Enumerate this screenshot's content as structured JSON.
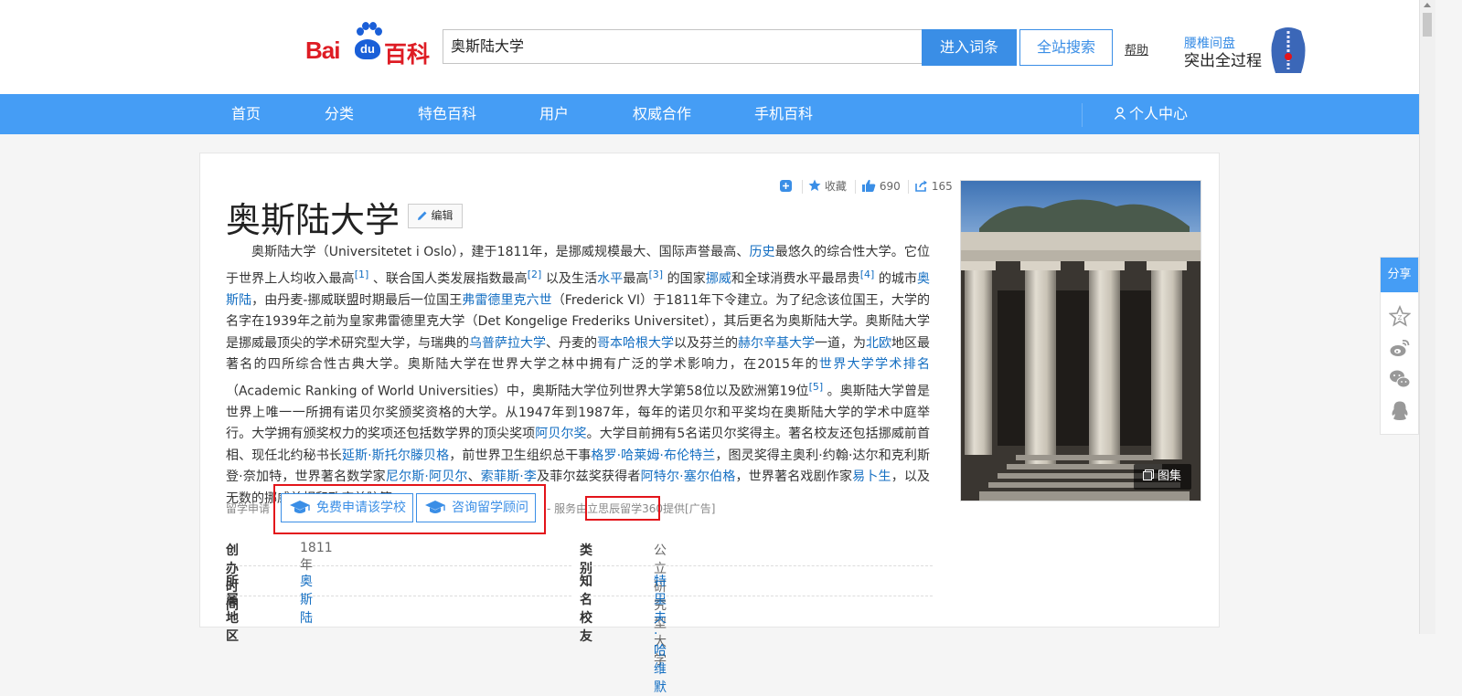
{
  "header": {
    "logo_text_left": "Bai",
    "logo_text_du": "du",
    "logo_text_right": "百科",
    "search_value": "奥斯陆大学",
    "enter_button": "进入词条",
    "site_search_button": "全站搜索",
    "help": "帮助",
    "ad_line1": "腰椎间盘",
    "ad_line2": "突出全过程"
  },
  "nav": {
    "items": [
      "首页",
      "分类",
      "特色百科",
      "用户",
      "权威合作",
      "手机百科"
    ],
    "personal_center": "个人中心"
  },
  "article": {
    "title": "奥斯陆大学",
    "edit_label": "编辑",
    "actions": {
      "favorite": "收藏",
      "likes": "690",
      "shares": "165"
    },
    "summary": [
      {
        "t": "奥斯陆大学（Universitetet i Oslo），建于1811年，是挪威规模最大、国际声誉最高、"
      },
      {
        "t": "历史",
        "link": true
      },
      {
        "t": "最悠久的综合性大学。它位于世界上人均收入最高"
      },
      {
        "t": "[1]",
        "sup": true
      },
      {
        "t": " 、联合国人类发展指数最高"
      },
      {
        "t": "[2]",
        "sup": true
      },
      {
        "t": " 以及生活"
      },
      {
        "t": "水平",
        "link": true
      },
      {
        "t": "最高"
      },
      {
        "t": "[3]",
        "sup": true
      },
      {
        "t": " 的国家"
      },
      {
        "t": "挪威",
        "link": true
      },
      {
        "t": "和全球消费水平最昂贵"
      },
      {
        "t": "[4]",
        "sup": true
      },
      {
        "t": " 的城市"
      },
      {
        "t": "奥斯陆",
        "link": true
      },
      {
        "t": "，由丹麦-挪威联盟时期最后一位国王"
      },
      {
        "t": "弗雷德里克六世",
        "link": true
      },
      {
        "t": "（Frederick VI）于1811年下令建立。为了纪念该位国王，大学的名字在1939年之前为皇家弗雷德里克大学（Det Kongelige Frederiks Universitet），其后更名为奥斯陆大学。奥斯陆大学是挪威最顶尖的学术研究型大学，与瑞典的"
      },
      {
        "t": "乌普萨拉大学",
        "link": true
      },
      {
        "t": "、丹麦的"
      },
      {
        "t": "哥本哈根大学",
        "link": true
      },
      {
        "t": "以及芬兰的"
      },
      {
        "t": "赫尔辛基大学",
        "link": true
      },
      {
        "t": "一道，为"
      },
      {
        "t": "北欧",
        "link": true
      },
      {
        "t": "地区最著名的四所综合性古典大学。奥斯陆大学在世界大学之林中拥有广泛的学术影响力，在2015年的"
      },
      {
        "t": "世界大学学术排名",
        "link": true
      },
      {
        "t": "（Academic Ranking of World Universities）中，奥斯陆大学位列世界大学第58位以及欧洲第19位"
      },
      {
        "t": "[5]",
        "sup": true
      },
      {
        "t": " 。奥斯陆大学曾是世界上唯一一所拥有诺贝尔奖颁奖资格的大学。从1947年到1987年，每年的诺贝尔和平奖均在奥斯陆大学的学术中庭举行。大学拥有颁奖权力的奖项还包括数学界的顶尖奖项"
      },
      {
        "t": "阿贝尔奖",
        "link": true
      },
      {
        "t": "。大学目前拥有5名诺贝尔奖得主。著名校友还包括挪威前首相、现任北约秘书长"
      },
      {
        "t": "延斯·斯托尔滕贝格",
        "link": true
      },
      {
        "t": "，前世界卫生组织总干事"
      },
      {
        "t": "格罗·哈莱姆·布伦特兰",
        "link": true
      },
      {
        "t": "，图灵奖得主奥利·约翰·达尔和克利斯登·奈加特，世界著名数学家"
      },
      {
        "t": "尼尔斯·阿贝尔",
        "link": true
      },
      {
        "t": "、"
      },
      {
        "t": "索菲斯·李",
        "link": true
      },
      {
        "t": "及菲尔兹奖获得者"
      },
      {
        "t": "阿特尔·塞尔伯格",
        "link": true
      },
      {
        "t": "，世界著名戏剧作家"
      },
      {
        "t": "易卜生",
        "link": true
      },
      {
        "t": "，以及无数的挪威首相和政府首脑等。"
      }
    ],
    "study": {
      "label": "留学申请",
      "btn_apply": "免费申请该学校",
      "btn_consult": "咨询留学顾问",
      "provider": "- 服务由立思辰留学360提供[广告]"
    },
    "info": [
      {
        "name": "创办时间",
        "value": "1811年",
        "link": false
      },
      {
        "name": "类别",
        "value": "公立研究型大学",
        "link": false
      },
      {
        "name": "所属地区",
        "value": "奥斯陆",
        "link": true
      },
      {
        "name": "知名校友",
        "value": "特里夫·哈维默",
        "link": true
      }
    ],
    "gallery_label": "图集"
  },
  "share": {
    "title": "分享"
  },
  "colors": {
    "nav_blue": "#459df5",
    "button_blue": "#3a8ee6",
    "link_blue": "#136ec2",
    "logo_red": "#de1c24",
    "annotation_red": "#e3141a"
  }
}
